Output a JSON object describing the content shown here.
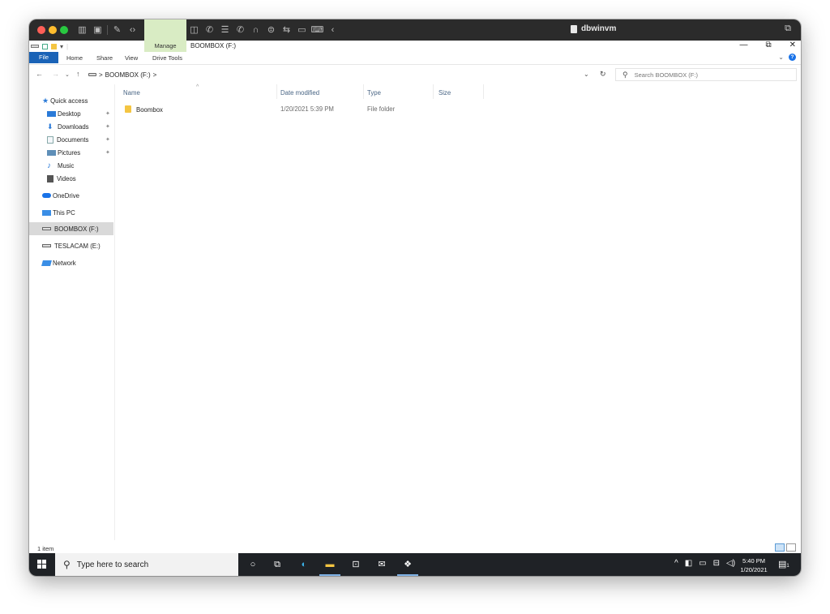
{
  "host": {
    "title": "dbwinvm",
    "toolbar_icons": [
      "wrench-icon",
      "code-icon",
      "printer-icon",
      "disk-icon",
      "speaker-icon",
      "camera-icon",
      "phone-icon",
      "database-icon",
      "phone2-icon",
      "headphones-icon",
      "usb-icon",
      "share-icon",
      "display-icon",
      "keyboard-icon",
      "back-icon"
    ]
  },
  "explorer": {
    "manage_label": "Manage",
    "window_title": "BOOMBOX (F:)",
    "ribbon_tabs": [
      "File",
      "Home",
      "Share",
      "View",
      "Drive Tools"
    ],
    "address": {
      "path": "BOOMBOX (F:)",
      "separator": ">",
      "search_placeholder": "Search BOOMBOX (F:)"
    },
    "nav": {
      "quick_access": "Quick access",
      "items": [
        {
          "label": "Desktop",
          "pinned": true
        },
        {
          "label": "Downloads",
          "pinned": true
        },
        {
          "label": "Documents",
          "pinned": true
        },
        {
          "label": "Pictures",
          "pinned": true
        },
        {
          "label": "Music",
          "pinned": false
        },
        {
          "label": "Videos",
          "pinned": false
        }
      ],
      "onedrive": "OneDrive",
      "this_pc": "This PC",
      "boombox": "BOOMBOX (F:)",
      "teslacam": "TESLACAM (E:)",
      "network": "Network"
    },
    "columns": {
      "name": "Name",
      "date": "Date modified",
      "type": "Type",
      "size": "Size"
    },
    "rows": [
      {
        "name": "Boombox",
        "date": "1/20/2021 5:39 PM",
        "type": "File folder",
        "size": ""
      }
    ],
    "status": "1 item"
  },
  "taskbar": {
    "search_placeholder": "Type here to search",
    "time": "5:40 PM",
    "date": "1/20/2021",
    "notification_count": "1"
  },
  "colors": {
    "accent": "#1a63b7",
    "manage": "#d9ecc4",
    "taskbar": "#1f2226"
  }
}
